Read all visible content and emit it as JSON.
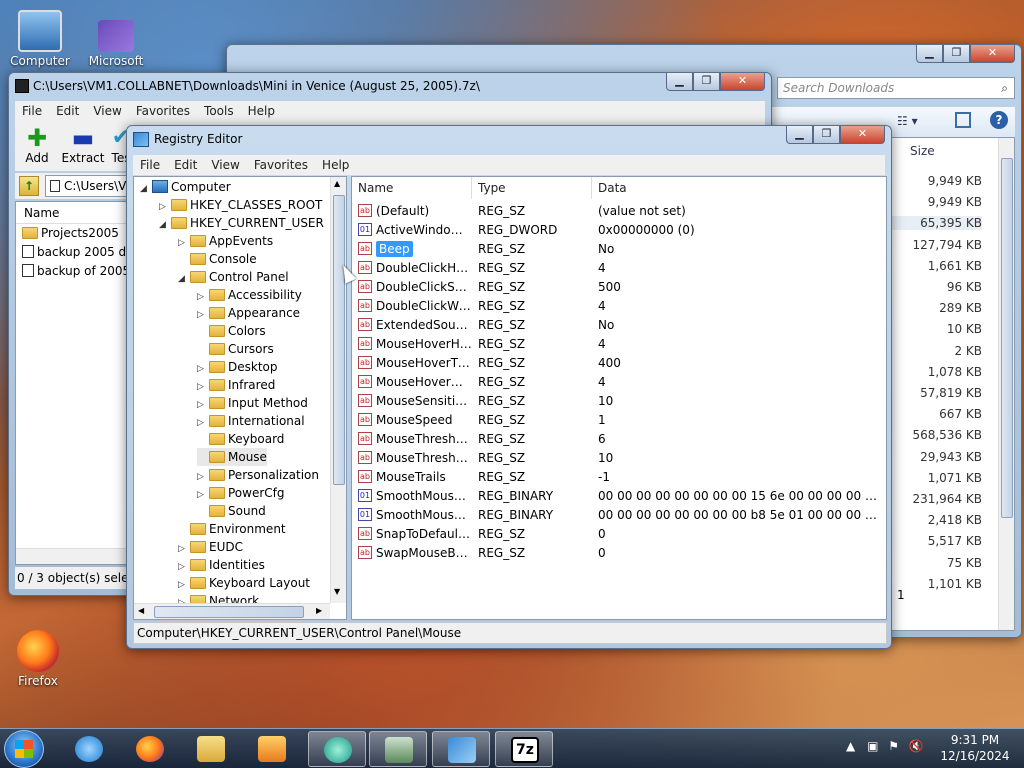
{
  "desktop": {
    "icons": [
      {
        "label": "Computer"
      },
      {
        "label": "Microsoft"
      },
      {
        "label": "Firefox"
      }
    ]
  },
  "explorer": {
    "search_placeholder": "Search Downloads",
    "size_header": "Size",
    "sizes": [
      "9,949 KB",
      "9,949 KB",
      "65,395 KB",
      "127,794 KB",
      "1,661 KB",
      "96 KB",
      "289 KB",
      "10 KB",
      "2 KB",
      "1,078 KB",
      "57,819 KB",
      "667 KB",
      "568,536 KB",
      "29,943 KB",
      "1,071 KB",
      "231,964 KB",
      "2,418 KB",
      "5,517 KB",
      "75 KB",
      "1,101 KB"
    ],
    "frag": "1"
  },
  "sevenzip": {
    "title": "C:\\Users\\VM1.COLLABNET\\Downloads\\Mini in Venice (August 25, 2005).7z\\",
    "menu": [
      "File",
      "Edit",
      "View",
      "Favorites",
      "Tools",
      "Help"
    ],
    "toolbar": {
      "add": "Add",
      "extract": "Extract",
      "test": "Tes"
    },
    "address": "C:\\Users\\V",
    "col_name": "Name",
    "files": [
      "Projects2005",
      "backup 2005 dsp",
      "backup of 2005 c"
    ],
    "status": "0 / 3 object(s) selecte"
  },
  "regedit": {
    "title": "Registry Editor",
    "menu": [
      "File",
      "Edit",
      "View",
      "Favorites",
      "Help"
    ],
    "tree": [
      {
        "label": "Computer"
      },
      {
        "label": "HKEY_CLASSES_ROOT"
      },
      {
        "label": "HKEY_CURRENT_USER"
      },
      {
        "label": "AppEvents"
      },
      {
        "label": "Console"
      },
      {
        "label": "Control Panel"
      },
      {
        "label": "Accessibility"
      },
      {
        "label": "Appearance"
      },
      {
        "label": "Colors"
      },
      {
        "label": "Cursors"
      },
      {
        "label": "Desktop"
      },
      {
        "label": "Infrared"
      },
      {
        "label": "Input Method"
      },
      {
        "label": "International"
      },
      {
        "label": "Keyboard"
      },
      {
        "label": "Mouse"
      },
      {
        "label": "Personalization"
      },
      {
        "label": "PowerCfg"
      },
      {
        "label": "Sound"
      },
      {
        "label": "Environment"
      },
      {
        "label": "EUDC"
      },
      {
        "label": "Identities"
      },
      {
        "label": "Keyboard Layout"
      },
      {
        "label": "Network"
      }
    ],
    "columns": {
      "name": "Name",
      "type": "Type",
      "data": "Data"
    },
    "values": [
      {
        "name": "(Default)",
        "type": "REG_SZ",
        "data": "(value not set)"
      },
      {
        "name": "ActiveWindowT...",
        "type": "REG_DWORD",
        "data": "0x00000000 (0)"
      },
      {
        "name": "Beep",
        "type": "REG_SZ",
        "data": "No"
      },
      {
        "name": "DoubleClickHei...",
        "type": "REG_SZ",
        "data": "4"
      },
      {
        "name": "DoubleClickSpeed",
        "type": "REG_SZ",
        "data": "500"
      },
      {
        "name": "DoubleClickWidth",
        "type": "REG_SZ",
        "data": "4"
      },
      {
        "name": "ExtendedSounds",
        "type": "REG_SZ",
        "data": "No"
      },
      {
        "name": "MouseHoverHei...",
        "type": "REG_SZ",
        "data": "4"
      },
      {
        "name": "MouseHoverTime",
        "type": "REG_SZ",
        "data": "400"
      },
      {
        "name": "MouseHoverWi...",
        "type": "REG_SZ",
        "data": "4"
      },
      {
        "name": "MouseSensitivity",
        "type": "REG_SZ",
        "data": "10"
      },
      {
        "name": "MouseSpeed",
        "type": "REG_SZ",
        "data": "1"
      },
      {
        "name": "MouseThreshold1",
        "type": "REG_SZ",
        "data": "6"
      },
      {
        "name": "MouseThreshold2",
        "type": "REG_SZ",
        "data": "10"
      },
      {
        "name": "MouseTrails",
        "type": "REG_SZ",
        "data": "-1"
      },
      {
        "name": "SmoothMouseX...",
        "type": "REG_BINARY",
        "data": "00 00 00 00 00 00 00 00 15 6e 00 00 00 00 00 00 00 40..."
      },
      {
        "name": "SmoothMouseY...",
        "type": "REG_BINARY",
        "data": "00 00 00 00 00 00 00 00 b8 5e 01 00 00 00 00 00 cd 4..."
      },
      {
        "name": "SnapToDefaultB...",
        "type": "REG_SZ",
        "data": "0"
      },
      {
        "name": "SwapMouseButt...",
        "type": "REG_SZ",
        "data": "0"
      }
    ],
    "status": "Computer\\HKEY_CURRENT_USER\\Control Panel\\Mouse"
  },
  "taskbar": {
    "time": "9:31 PM",
    "date": "12/16/2024",
    "sevenzip_label": "7z"
  }
}
